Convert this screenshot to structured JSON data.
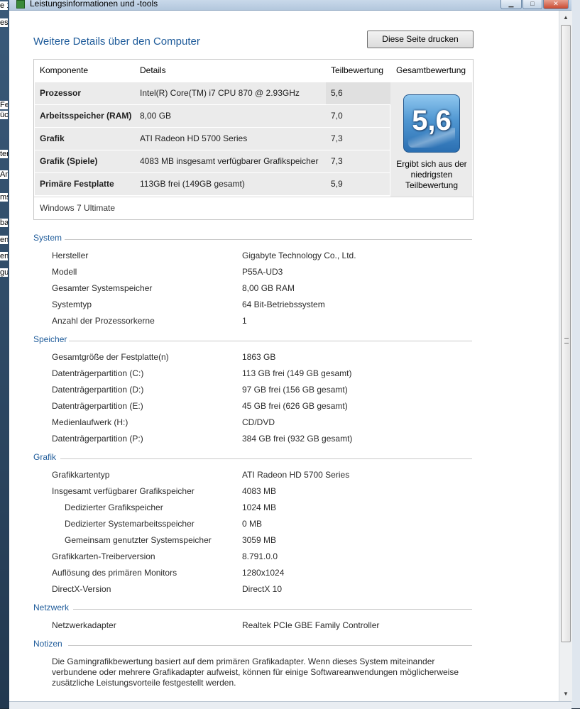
{
  "window": {
    "title": "Leistungsinformationen und -tools",
    "minimize_label": "▁",
    "maximize_label": "□",
    "close_label": "✕"
  },
  "background_fragments": [
    "e 1",
    "ese",
    "Fe",
    "üc",
    "ter",
    "An",
    "ms",
    "bas",
    "en",
    "en",
    "gu"
  ],
  "page": {
    "heading": "Weitere Details über den Computer",
    "print_button": "Diese Seite drucken"
  },
  "perf_table": {
    "headers": {
      "component": "Komponente",
      "details": "Details",
      "subscore": "Teilbewertung",
      "basescore": "Gesamtbewertung"
    },
    "rows": [
      {
        "component": "Prozessor",
        "details": "Intel(R) Core(TM) i7 CPU 870 @ 2.93GHz",
        "subscore": "5,6"
      },
      {
        "component": "Arbeitsspeicher (RAM)",
        "details": "8,00 GB",
        "subscore": "7,0"
      },
      {
        "component": "Grafik",
        "details": "ATI Radeon HD 5700 Series",
        "subscore": "7,3"
      },
      {
        "component": "Grafik (Spiele)",
        "details": "4083 MB insgesamt verfügbarer Grafikspeicher",
        "subscore": "7,3"
      },
      {
        "component": "Primäre Festplatte",
        "details": "113GB frei (149GB gesamt)",
        "subscore": "5,9"
      }
    ],
    "basescore": "5,6",
    "basescore_note": "Ergibt sich aus der niedrigsten Teilbewertung",
    "os": "Windows 7 Ultimate"
  },
  "sections": {
    "system": {
      "title": "System",
      "rows": [
        {
          "label": "Hersteller",
          "value": "Gigabyte Technology Co., Ltd."
        },
        {
          "label": "Modell",
          "value": "P55A-UD3"
        },
        {
          "label": "Gesamter Systemspeicher",
          "value": "8,00 GB RAM"
        },
        {
          "label": "Systemtyp",
          "value": "64 Bit-Betriebssystem"
        },
        {
          "label": "Anzahl der Prozessorkerne",
          "value": "1"
        }
      ]
    },
    "storage": {
      "title": "Speicher",
      "rows": [
        {
          "label": "Gesamtgröße der Festplatte(n)",
          "value": "1863 GB"
        },
        {
          "label": "Datenträgerpartition (C:)",
          "value": "113 GB frei (149 GB gesamt)"
        },
        {
          "label": "Datenträgerpartition (D:)",
          "value": "97 GB frei (156 GB gesamt)"
        },
        {
          "label": "Datenträgerpartition (E:)",
          "value": "45 GB frei (626 GB gesamt)"
        },
        {
          "label": "Medienlaufwerk (H:)",
          "value": "CD/DVD"
        },
        {
          "label": "Datenträgerpartition (P:)",
          "value": "384 GB frei (932 GB gesamt)"
        }
      ]
    },
    "graphics": {
      "title": "Grafik",
      "rows": [
        {
          "label": "Grafikkartentyp",
          "value": "ATI Radeon HD 5700 Series"
        },
        {
          "label": "Insgesamt verfügbarer Grafikspeicher",
          "value": "4083 MB"
        },
        {
          "label": "Dedizierter Grafikspeicher",
          "value": "1024 MB"
        },
        {
          "label": "Dedizierter Systemarbeitsspeicher",
          "value": "0 MB"
        },
        {
          "label": "Gemeinsam genutzter Systemspeicher",
          "value": "3059 MB"
        },
        {
          "label": "Grafikkarten-Treiberversion",
          "value": "8.791.0.0"
        },
        {
          "label": "Auflösung des primären Monitors",
          "value": "1280x1024"
        },
        {
          "label": "DirectX-Version",
          "value": "DirectX 10"
        }
      ]
    },
    "network": {
      "title": "Netzwerk",
      "rows": [
        {
          "label": "Netzwerkadapter",
          "value": "Realtek PCIe GBE Family Controller"
        }
      ]
    },
    "notes": {
      "title": "Notizen",
      "text": "Die Gamingrafikbewertung basiert auf dem primären Grafikadapter. Wenn dieses System miteinander verbundene oder mehrere Grafikadapter aufweist, können für einige Softwareanwendungen möglicherweise zusätzliche Leistungsvorteile festgestellt werden."
    }
  }
}
